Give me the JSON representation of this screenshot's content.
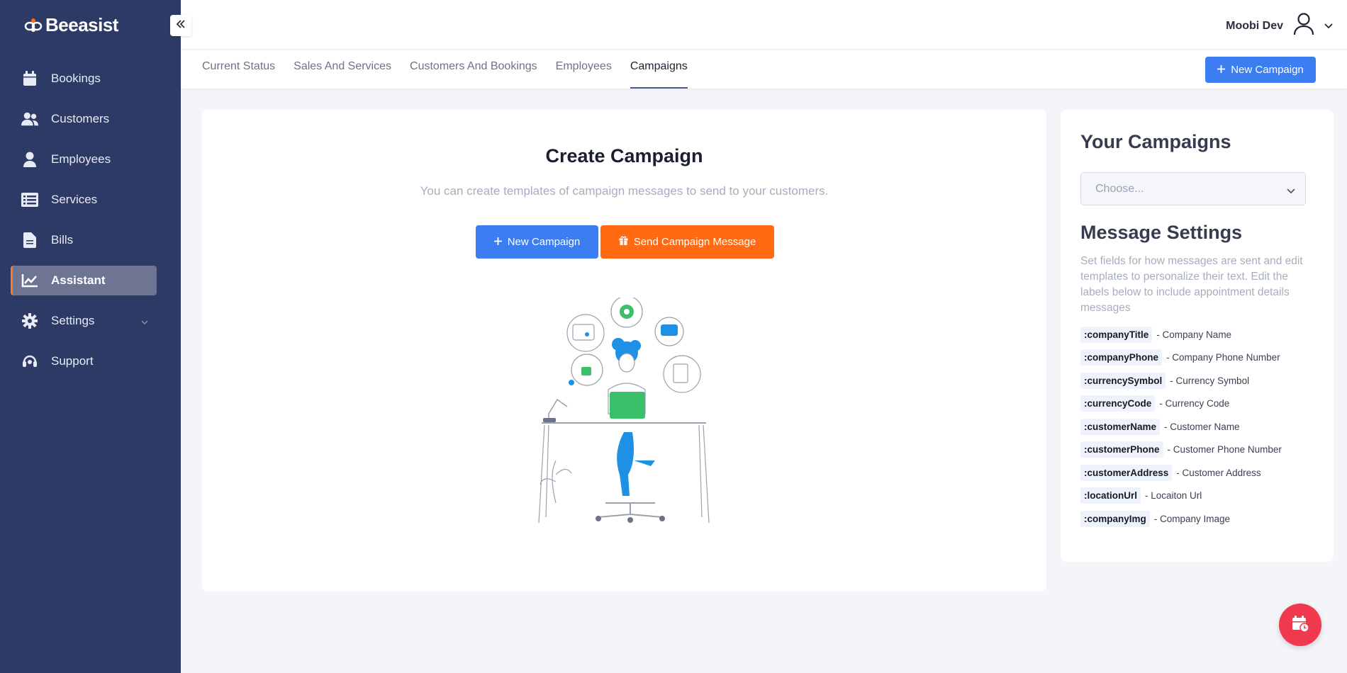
{
  "brand": {
    "name": "Beeasist"
  },
  "sidebar": {
    "items": [
      {
        "label": "Bookings",
        "icon": "calendar-icon"
      },
      {
        "label": "Customers",
        "icon": "users-icon"
      },
      {
        "label": "Employees",
        "icon": "user-icon"
      },
      {
        "label": "Services",
        "icon": "list-icon"
      },
      {
        "label": "Bills",
        "icon": "file-icon"
      },
      {
        "label": "Assistant",
        "icon": "chart-line-icon",
        "active": true
      },
      {
        "label": "Settings",
        "icon": "gear-icon"
      },
      {
        "label": "Support",
        "icon": "headset-icon"
      }
    ]
  },
  "header": {
    "user_name": "Moobi Dev"
  },
  "tabs": [
    {
      "label": "Current Status"
    },
    {
      "label": "Sales And Services"
    },
    {
      "label": "Customers And Bookings"
    },
    {
      "label": "Employees"
    },
    {
      "label": "Campaigns",
      "active": true
    }
  ],
  "toolbar": {
    "new_campaign_label": "New Campaign"
  },
  "main": {
    "title": "Create Campaign",
    "subtitle": "You can create templates of campaign messages to send to your customers.",
    "new_campaign_label": "New Campaign",
    "send_message_label": "Send Campaign Message"
  },
  "side": {
    "campaigns_title": "Your Campaigns",
    "select_placeholder": "Choose...",
    "settings_title": "Message Settings",
    "settings_desc": "Set fields for how messages are sent and edit templates to personalize their text. Edit the labels below to include appointment details messages",
    "fields": [
      {
        "key": ":companyTitle",
        "desc": "- Company Name"
      },
      {
        "key": ":companyPhone",
        "desc": "- Company Phone Number"
      },
      {
        "key": ":currencySymbol",
        "desc": "- Currency Symbol"
      },
      {
        "key": ":currencyCode",
        "desc": "- Currency Code"
      },
      {
        "key": ":customerName",
        "desc": "- Customer Name"
      },
      {
        "key": ":customerPhone",
        "desc": "- Customer Phone Number"
      },
      {
        "key": ":customerAddress",
        "desc": "- Customer Address"
      },
      {
        "key": ":locationUrl",
        "desc": "- Locaiton Url"
      },
      {
        "key": ":companyImg",
        "desc": "- Company Image"
      }
    ]
  },
  "colors": {
    "sidebar": "#2e3a66",
    "primary": "#3d7df2",
    "orange": "#ff6a13",
    "fab": "#f0394f",
    "active_accent": "#ff7a1a"
  }
}
